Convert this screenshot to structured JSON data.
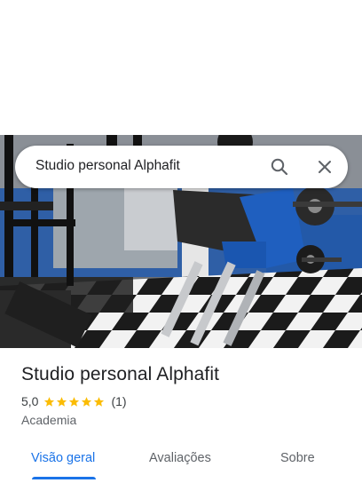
{
  "search": {
    "query": "Studio personal Alphafit",
    "search_icon": "search-icon",
    "close_icon": "close-icon"
  },
  "place": {
    "title": "Studio personal Alphafit",
    "rating": "5,0",
    "stars_filled": 5,
    "review_count": "(1)",
    "category": "Academia"
  },
  "tabs": [
    {
      "label": "Visão geral",
      "active": true
    },
    {
      "label": "Avaliações",
      "active": false
    },
    {
      "label": "Sobre",
      "active": false
    }
  ],
  "colors": {
    "accent": "#1a73e8",
    "star": "#fbbc04",
    "text_primary": "#202124",
    "text_secondary": "#5f6368"
  }
}
